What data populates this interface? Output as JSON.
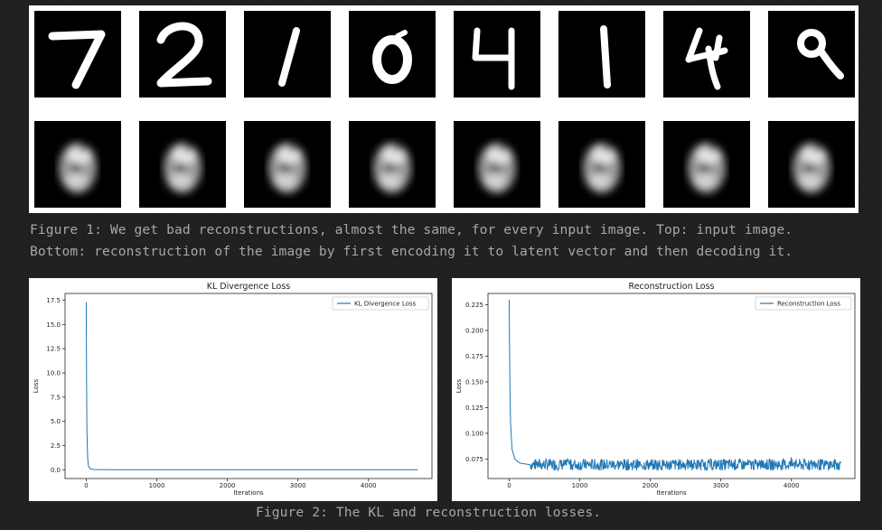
{
  "figure1": {
    "caption_line1": "Figure 1: We get bad reconstructions, almost the same, for every input image. Top: input image.",
    "caption_line2": "Bottom: reconstruction of the image by first encoding it to latent vector and then decoding it.",
    "input_digits": [
      "7",
      "2",
      "1",
      "0",
      "4",
      "1",
      "4",
      "9"
    ],
    "reconstructions": [
      "9",
      "9",
      "9",
      "9",
      "9",
      "9",
      "9",
      "9"
    ]
  },
  "figure2": {
    "caption": "Figure 2: The KL and reconstruction losses."
  },
  "chart_data": [
    {
      "type": "line",
      "title": "KL Divergence Loss",
      "xlabel": "Iterations",
      "ylabel": "Loss",
      "xticks": [
        "0",
        "1000",
        "2000",
        "3000",
        "4000"
      ],
      "yticks": [
        "0.0",
        "2.5",
        "5.0",
        "7.5",
        "10.0",
        "12.5",
        "15.0",
        "17.5"
      ],
      "xlim": [
        -300,
        4900
      ],
      "ylim": [
        -0.9,
        18.2
      ],
      "legend": "top-right",
      "series": [
        {
          "name": "KL Divergence Loss",
          "color": "#1f77b4",
          "x": [
            0,
            5,
            10,
            20,
            30,
            50,
            80,
            120,
            200,
            400,
            1000,
            2000,
            3000,
            4000,
            4700
          ],
          "y": [
            17.3,
            9.0,
            4.0,
            1.2,
            0.45,
            0.15,
            0.06,
            0.03,
            0.02,
            0.01,
            0.01,
            0.01,
            0.01,
            0.01,
            0.01
          ]
        }
      ]
    },
    {
      "type": "line",
      "title": "Reconstruction Loss",
      "xlabel": "Iterations",
      "ylabel": "Loss",
      "xticks": [
        "0",
        "1000",
        "2000",
        "3000",
        "4000"
      ],
      "yticks": [
        "0.075",
        "0.100",
        "0.125",
        "0.150",
        "0.175",
        "0.200",
        "0.225"
      ],
      "xlim": [
        -300,
        4900
      ],
      "ylim": [
        0.056,
        0.236
      ],
      "legend": "top-right",
      "series": [
        {
          "name": "Reconstruction Loss",
          "color": "#1f77b4",
          "x": [
            0,
            10,
            20,
            40,
            80,
            150,
            300,
            1000,
            2000,
            3000,
            4000,
            4700
          ],
          "y": [
            0.23,
            0.15,
            0.11,
            0.085,
            0.075,
            0.071,
            0.069,
            0.069,
            0.068,
            0.069,
            0.068,
            0.069
          ],
          "noise_band": [
            0.062,
            0.077
          ]
        }
      ]
    }
  ]
}
